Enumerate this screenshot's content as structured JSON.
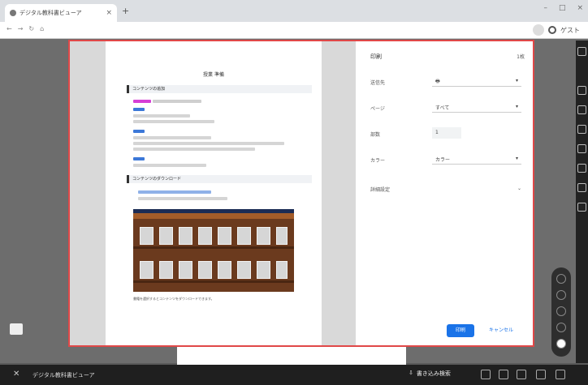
{
  "browser": {
    "tab_title": "デジタル教科書ビューア",
    "tab_close": "×",
    "new_tab": "+",
    "nav_icons": [
      "←",
      "→",
      "↻",
      "⌂"
    ],
    "window_controls": [
      "–",
      "□",
      "×"
    ],
    "profile_text": "ゲスト"
  },
  "document": {
    "title": "授業 準備",
    "heading_1": "コンテンツの追加",
    "heading_2": "コンテンツのダウンロード",
    "caption": "書籍を選択するとコンテンツをダウンロードできます。"
  },
  "print_panel": {
    "title": "印刷",
    "sheet_count": "1枚",
    "destination_label": "送信先",
    "destination_value": "",
    "pages_label": "ページ",
    "pages_value": "すべて",
    "copies_label": "部数",
    "copies_value": "1",
    "color_label": "カラー",
    "color_value": "カラー",
    "more_settings_label": "詳細設定",
    "print_button": "印刷",
    "cancel_button": "キャンセル"
  },
  "bottom_bar": {
    "close_icon": "✕",
    "title": "デジタル教科書ビューア",
    "search_label": "書き込み検索"
  },
  "icons": {
    "chevron": "▾",
    "expand": "⌄"
  },
  "colors": {
    "dialog_border": "#e04848",
    "primary_button": "#1a73e8",
    "shelf": "#6b3a1e"
  }
}
